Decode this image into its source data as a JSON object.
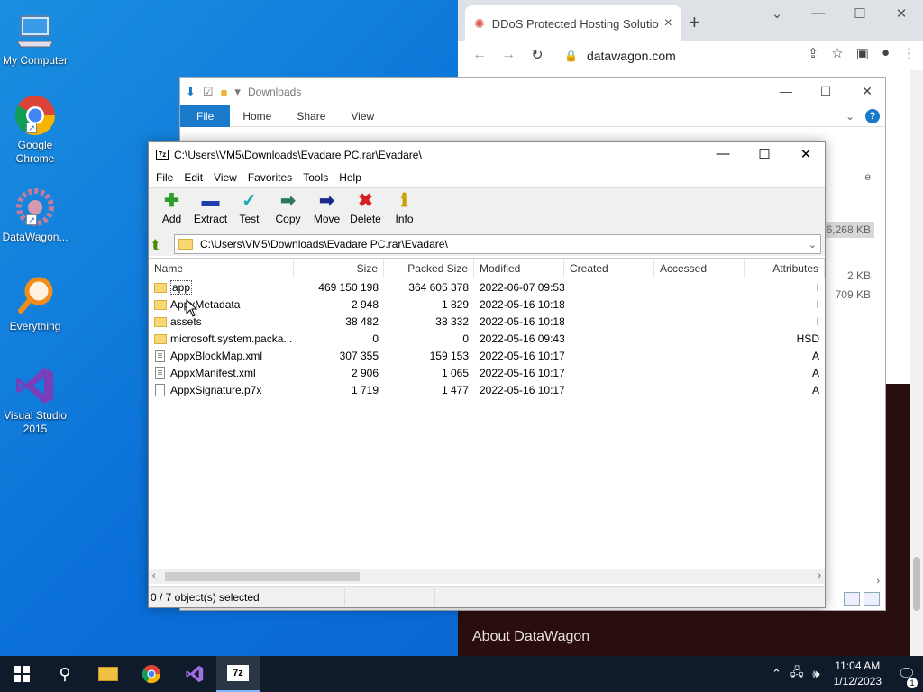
{
  "desktop": {
    "icons": [
      {
        "label": "My Computer"
      },
      {
        "label": "Google Chrome"
      },
      {
        "label": "DataWagon..."
      },
      {
        "label": "Everything"
      },
      {
        "label": "Visual Studio 2015"
      }
    ]
  },
  "chrome": {
    "tab_title": "DDoS Protected Hosting Solutio",
    "url": "datawagon.com",
    "footer_link": "About DataWagon"
  },
  "explorer": {
    "title": "Downloads",
    "ribbon_tabs": [
      "File",
      "Home",
      "Share",
      "View"
    ],
    "side_values": [
      "e",
      "56,268 KB",
      "2 KB",
      "709 KB"
    ]
  },
  "sevenzip": {
    "title": "C:\\Users\\VM5\\Downloads\\Evadare PC.rar\\Evadare\\",
    "menu": [
      "File",
      "Edit",
      "View",
      "Favorites",
      "Tools",
      "Help"
    ],
    "toolbar": [
      {
        "label": "Add",
        "icon": "plus-icon"
      },
      {
        "label": "Extract",
        "icon": "minus-icon"
      },
      {
        "label": "Test",
        "icon": "check-icon"
      },
      {
        "label": "Copy",
        "icon": "copy-arrow-icon"
      },
      {
        "label": "Move",
        "icon": "move-arrow-icon"
      },
      {
        "label": "Delete",
        "icon": "delete-x-icon"
      },
      {
        "label": "Info",
        "icon": "info-icon"
      }
    ],
    "address": "C:\\Users\\VM5\\Downloads\\Evadare PC.rar\\Evadare\\",
    "columns": [
      "Name",
      "Size",
      "Packed Size",
      "Modified",
      "Created",
      "Accessed",
      "Attributes"
    ],
    "rows": [
      {
        "name": "app",
        "type": "folder",
        "size": "469 150 198",
        "packed": "364 605 378",
        "modified": "2022-06-07 09:53",
        "created": "",
        "accessed": "",
        "attr": "I"
      },
      {
        "name": "AppxMetadata",
        "type": "folder",
        "size": "2 948",
        "packed": "1 829",
        "modified": "2022-05-16 10:18",
        "created": "",
        "accessed": "",
        "attr": "I"
      },
      {
        "name": "assets",
        "type": "folder",
        "size": "38 482",
        "packed": "38 332",
        "modified": "2022-05-16 10:18",
        "created": "",
        "accessed": "",
        "attr": "I"
      },
      {
        "name": "microsoft.system.packa...",
        "type": "folder",
        "size": "0",
        "packed": "0",
        "modified": "2022-05-16 09:43",
        "created": "",
        "accessed": "",
        "attr": "HSD"
      },
      {
        "name": "AppxBlockMap.xml",
        "type": "xml",
        "size": "307 355",
        "packed": "159 153",
        "modified": "2022-05-16 10:17",
        "created": "",
        "accessed": "",
        "attr": "A"
      },
      {
        "name": "AppxManifest.xml",
        "type": "xml",
        "size": "2 906",
        "packed": "1 065",
        "modified": "2022-05-16 10:17",
        "created": "",
        "accessed": "",
        "attr": "A"
      },
      {
        "name": "AppxSignature.p7x",
        "type": "file",
        "size": "1 719",
        "packed": "1 477",
        "modified": "2022-05-16 10:17",
        "created": "",
        "accessed": "",
        "attr": "A"
      }
    ],
    "status": "0 / 7 object(s) selected"
  },
  "taskbar": {
    "time": "11:04 AM",
    "date": "1/12/2023",
    "notifications": "1"
  }
}
